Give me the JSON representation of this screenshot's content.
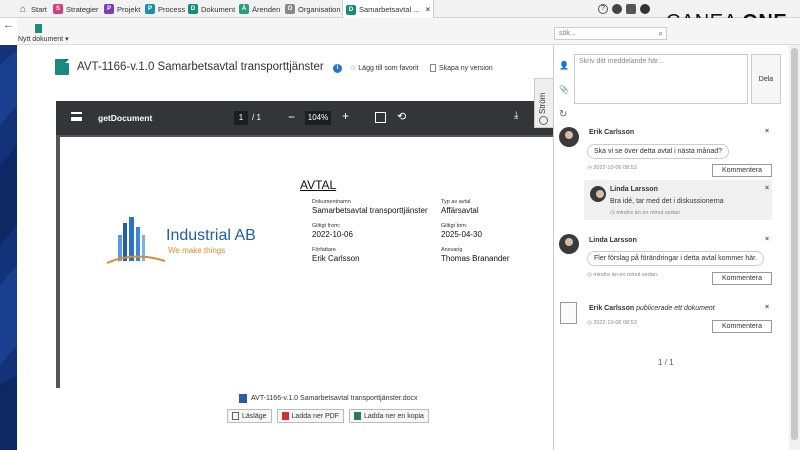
{
  "tabs": [
    {
      "label": "Start",
      "color": "#555"
    },
    {
      "label": "Strategier",
      "color": "#d83c7a"
    },
    {
      "label": "Projekt",
      "color": "#7a3cbf"
    },
    {
      "label": "Process",
      "color": "#1f8fa8"
    },
    {
      "label": "Dokument",
      "color": "#1a8a7d"
    },
    {
      "label": "Ärenden",
      "color": "#27a07a"
    },
    {
      "label": "Organisation",
      "color": "#666"
    },
    {
      "label": "Samarbetsavtal ...",
      "color": "#1a8a7d"
    }
  ],
  "brand": {
    "logo_light": "CANEA ",
    "logo_bold": "ONE"
  },
  "toolbar": {
    "new_doc_label": "Nytt dokument",
    "search_placeholder": "sök..."
  },
  "document": {
    "title": "AVT-1166-v.1.0 Samarbetsavtal transporttjänster",
    "favorite_label": "Lägg till som favorit",
    "new_version_label": "Skapa ny version",
    "file_name": "AVT-1166-v.1.0 Samarbetsavtal transporttjänster.docx",
    "btn_read": "Läsläge",
    "btn_pdf": "Ladda ner PDF",
    "btn_copy": "Ladda ner en kopia"
  },
  "pdf": {
    "name": "getDocument",
    "page_current": "1",
    "page_total": "/ 1",
    "zoom": "104%",
    "heading": "AVTAL",
    "company_name": "Industrial AB",
    "company_slogan": "We make things",
    "fields": {
      "docname_label": "Dokumentnamn",
      "docname_value": "Samarbetsavtal transporttjänster",
      "type_label": "Typ av avtal",
      "type_value": "Affärsavtal",
      "from_label": "Giltigt from:",
      "from_value": "2022-10-06",
      "to_label": "Giltigt tom:",
      "to_value": "2025-04-30",
      "author_label": "Författare",
      "author_value": "Erik Carlsson",
      "resp_label": "Ansvarig",
      "resp_value": "Thomas Branander"
    }
  },
  "stream": {
    "tab_label": "Ström",
    "message_placeholder": "Skriv ditt meddelande här...",
    "share_label": "Dela",
    "comment_btn": "Kommentera",
    "pager": "1 / 1",
    "items": [
      {
        "name": "Erik Carlsson",
        "text": "Ska vi se över detta avtal i nästa månad?",
        "time": "2022-10-06 08:53"
      },
      {
        "name": "Linda Larsson",
        "text": "Bra idé, tar med det i diskussionerna",
        "time": "mindre än en minut sedan"
      },
      {
        "name": "Linda Larsson",
        "text": "Fler förslag på förändringar i detta avtal kommer här.",
        "time": "mindre än en minut sedan."
      },
      {
        "name": "Erik Carlsson",
        "text": "publicerade ett dokument",
        "time": "2022-10-06 08:53"
      }
    ]
  }
}
